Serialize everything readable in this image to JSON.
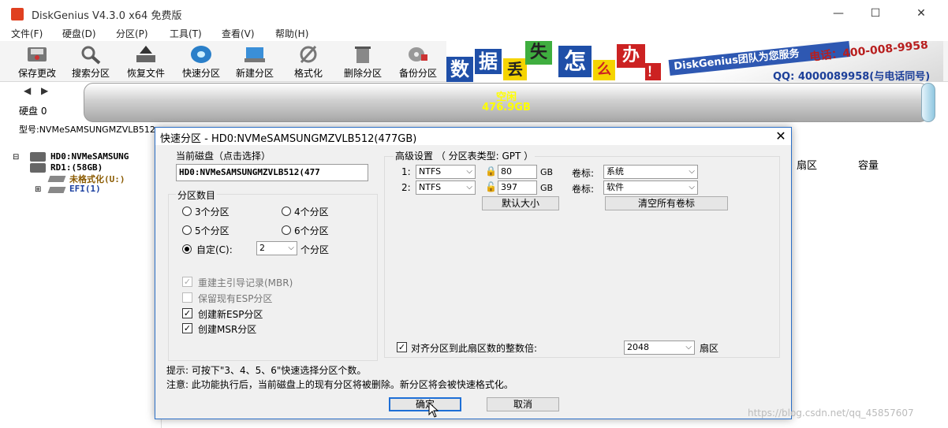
{
  "window": {
    "title": "DiskGenius V4.3.0 x64 免费版",
    "controls": [
      "—",
      "☐",
      "✕"
    ]
  },
  "menu": [
    "文件(F)",
    "硬盘(D)",
    "分区(P)",
    "工具(T)",
    "查看(V)",
    "帮助(H)"
  ],
  "toolbar": [
    "保存更改",
    "搜索分区",
    "恢复文件",
    "快速分区",
    "新建分区",
    "格式化",
    "删除分区",
    "备份分区"
  ],
  "banner": {
    "chars": [
      "数",
      "据",
      "丢",
      "失",
      "怎",
      "么",
      "办",
      "！"
    ],
    "brand": "DiskGenius团队为您服务",
    "phone": "电话：400-008-9958",
    "qq": "QQ: 4000089958(与电话同号)"
  },
  "disk": {
    "label": "硬盘 0",
    "free_label": "空闲",
    "free_size": "476.9GB",
    "model_line": "型号:NVMeSAMSUNGMZVLB512"
  },
  "tree": {
    "hd0": "HD0:NVMeSAMSUNG",
    "rd1": "RD1:(58GB)",
    "unformatted": "未格式化(U:)",
    "efi": "EFI(1)"
  },
  "right_headers": [
    "扇区",
    "容量"
  ],
  "dialog": {
    "title": "快速分区 - HD0:NVMeSAMSUNGMZVLB512(477GB)",
    "close": "✕",
    "current_disk_label": "当前磁盘（点击选择）",
    "current_disk_value": "HD0:NVMeSAMSUNGMZVLB512(477",
    "count_group": "分区数目",
    "options": {
      "three": "3个分区",
      "four": "4个分区",
      "five": "5个分区",
      "six": "6个分区",
      "custom": "自定(C):",
      "custom_value": "2",
      "custom_suffix": "个分区"
    },
    "checks": {
      "rebuild_mbr": "重建主引导记录(MBR)",
      "keep_esp": "保留现有ESP分区",
      "create_esp": "创建新ESP分区",
      "create_msr": "创建MSR分区"
    },
    "advanced": {
      "title": "高级设置 （ 分区表类型: GPT ）",
      "rows": [
        {
          "index": "1:",
          "fs": "NTFS",
          "size": "80",
          "unit": "GB",
          "vol_label": "卷标:",
          "vol_value": "系统"
        },
        {
          "index": "2:",
          "fs": "NTFS",
          "size": "397",
          "unit": "GB",
          "vol_label": "卷标:",
          "vol_value": "软件"
        }
      ],
      "default_size_btn": "默认大小",
      "clear_labels_btn": "清空所有卷标",
      "align_label": "对齐分区到此扇区数的整数倍:",
      "align_value": "2048",
      "align_unit": "扇区"
    },
    "hint1": "提示: 可按下\"3、4、5、6\"快速选择分区个数。",
    "hint2": "注意: 此功能执行后，当前磁盘上的现有分区将被删除。新分区将会被快速格式化。",
    "ok": "确定",
    "cancel": "取消"
  },
  "watermark": "https://blog.csdn.net/qq_45857607"
}
